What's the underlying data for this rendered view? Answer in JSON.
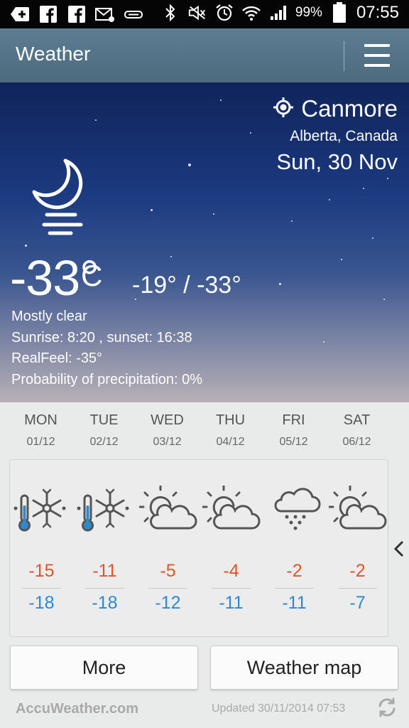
{
  "status_bar": {
    "battery": "99%",
    "time": "07:55",
    "left_icons": [
      "add-icon",
      "facebook-icon",
      "facebook-icon",
      "email-icon",
      "transfer-icon"
    ],
    "right_icons": [
      "bluetooth-icon",
      "mute-icon",
      "alarm-icon",
      "wifi-icon",
      "signal-icon",
      "battery-icon"
    ]
  },
  "app_bar": {
    "title": "Weather",
    "menu_icon": "menu-icon"
  },
  "current": {
    "city": "Canmore",
    "region": "Alberta, Canada",
    "date": "Sun, 30 Nov",
    "icon": "moon-fog-icon",
    "temperature": "-33°",
    "unit": "C",
    "range": "-19° / -33°",
    "condition": "Mostly clear",
    "sun": "Sunrise: 8:20 , sunset: 16:38",
    "realfeel": "RealFeel: -35°",
    "precipitation": "Probability of precipitation: 0%"
  },
  "forecast": [
    {
      "day": "MON",
      "date": "01/12",
      "icon": "snow-cold-icon",
      "high": "-15",
      "low": "-18"
    },
    {
      "day": "TUE",
      "date": "02/12",
      "icon": "snow-cold-icon",
      "high": "-11",
      "low": "-18"
    },
    {
      "day": "WED",
      "date": "03/12",
      "icon": "partly-cloudy-icon",
      "high": "-5",
      "low": "-12"
    },
    {
      "day": "THU",
      "date": "04/12",
      "icon": "partly-cloudy-icon",
      "high": "-4",
      "low": "-11"
    },
    {
      "day": "FRI",
      "date": "05/12",
      "icon": "snow-cloud-icon",
      "high": "-2",
      "low": "-11"
    },
    {
      "day": "SAT",
      "date": "06/12",
      "icon": "partly-cloudy-icon",
      "high": "-2",
      "low": "-7"
    }
  ],
  "buttons": {
    "more": "More",
    "weather_map": "Weather map"
  },
  "footer": {
    "brand": "AccuWeather.com",
    "updated": "Updated 30/11/2014 07:53"
  },
  "colors": {
    "high": "#e0542a",
    "low": "#2c8ad0",
    "app_bar": "#56758a"
  }
}
